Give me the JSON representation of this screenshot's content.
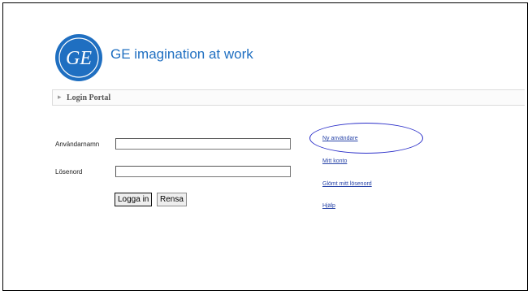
{
  "brand": {
    "logo_text": "GE imagination at work",
    "logo_icon": "ge-monogram-icon",
    "accent_color": "#1f6fc1"
  },
  "portal": {
    "title": "Login Portal"
  },
  "form": {
    "username_label": "Användarnamn",
    "username_value": "",
    "password_label": "Lösenord",
    "password_value": "",
    "login_button": "Logga in",
    "reset_button": "Rensa"
  },
  "links": {
    "new_user": "Ny användare",
    "my_account": "Mitt konto",
    "forgot_password": "Glömt mitt lösenord",
    "help": "Hjälp"
  },
  "annotation": {
    "highlight_color": "#2b2fc9"
  }
}
